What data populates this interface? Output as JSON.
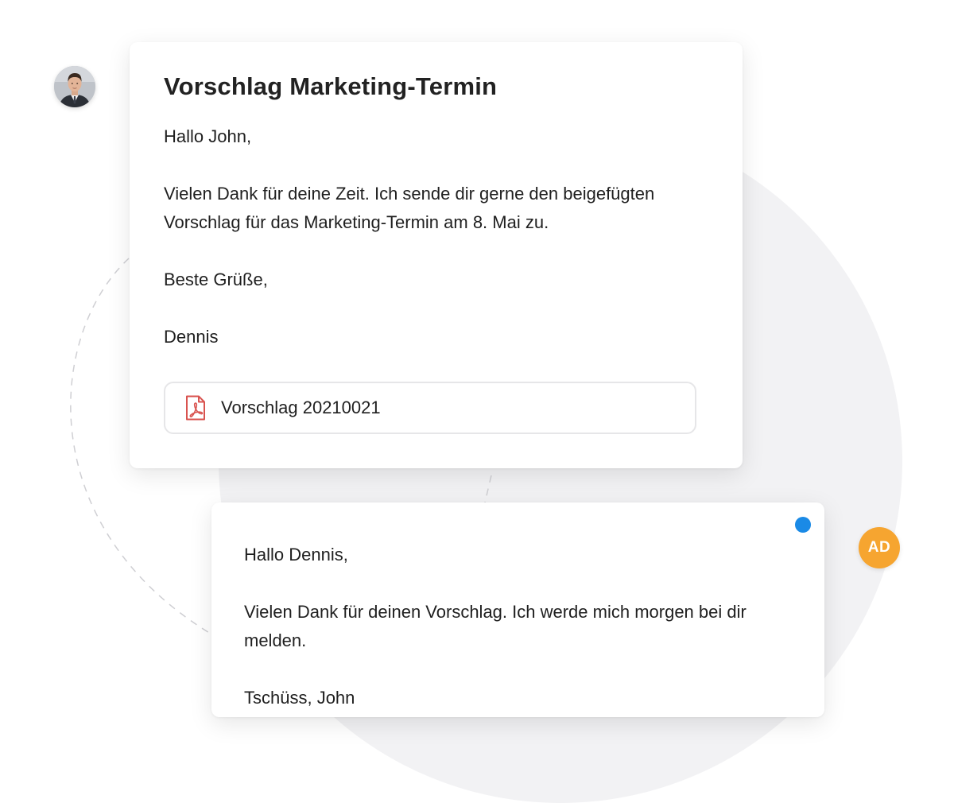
{
  "email": {
    "title": "Vorschlag Marketing-Termin",
    "paragraphs": [
      "Hallo John,",
      "Vielen Dank für deine Zeit. Ich sende dir gerne den beigefügten Vorschlag für das Marketing-Termin am 8. Mai zu.",
      "Beste Grüße,",
      "Dennis"
    ],
    "attachment": {
      "name": "Vorschlag 20210021",
      "icon": "pdf-file-icon"
    },
    "sender_avatar": {
      "type": "photo"
    }
  },
  "reply": {
    "paragraphs": [
      "Hallo Dennis,",
      "Vielen Dank für deinen Vorschlag. Ich werde mich morgen bei dir melden.",
      "Tschüss, John"
    ],
    "unread_indicator": true,
    "sender_avatar": {
      "initials": "AD"
    }
  },
  "colors": {
    "avatar_initials_bg": "#f6a530",
    "unread_dot": "#1a8ae6",
    "pdf_icon": "#d9534f",
    "background_circle": "#f2f2f4"
  }
}
